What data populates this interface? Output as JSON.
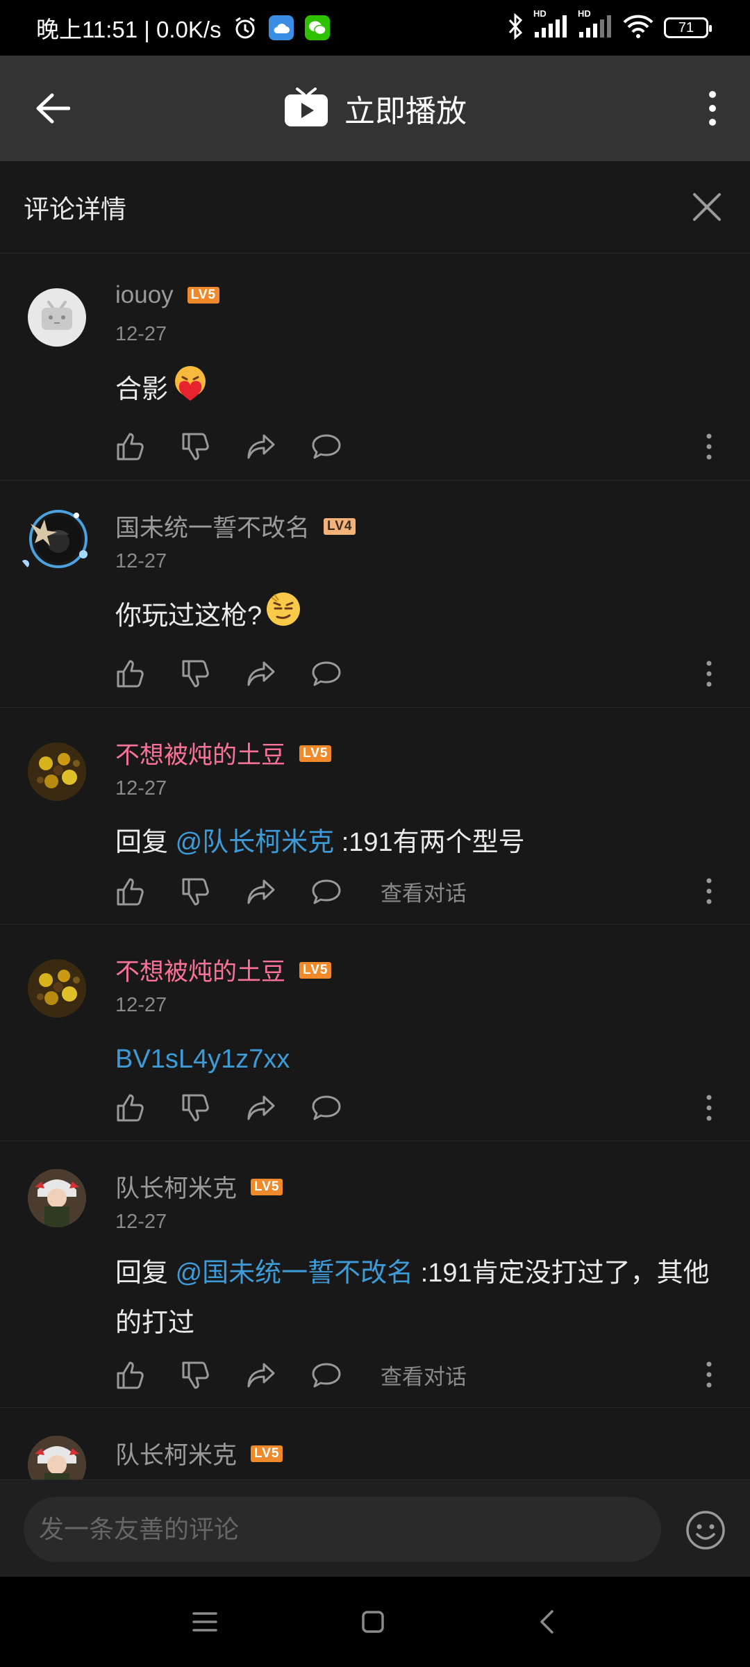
{
  "status_bar": {
    "time": "晚上11:51 | 0.0K/s",
    "hd1": "HD",
    "hd2": "HD",
    "battery": "71"
  },
  "app_bar": {
    "title": "立即播放"
  },
  "detail": {
    "title": "评论详情"
  },
  "comments": [
    {
      "username": "iouoy",
      "level": "LV5",
      "date": "12-27",
      "text": "合影"
    },
    {
      "username": "国未统一誓不改名",
      "level": "LV4",
      "date": "12-27",
      "text": "你玩过这枪?"
    },
    {
      "username": "不想被炖的土豆",
      "level": "LV5",
      "date": "12-27",
      "reply_prefix": "回复 ",
      "mention": "@队长柯米克",
      "text": " :191有两个型号",
      "view_conversation": "查看对话"
    },
    {
      "username": "不想被炖的土豆",
      "level": "LV5",
      "date": "12-27",
      "link": "BV1sL4y1z7xx"
    },
    {
      "username": "队长柯米克",
      "level": "LV5",
      "date": "12-27",
      "reply_prefix": "回复 ",
      "mention": "@国未统一誓不改名",
      "text": " :191肯定没打过了，其他的打过",
      "view_conversation": "查看对话"
    },
    {
      "username": "队长柯米克",
      "level": "LV5"
    }
  ],
  "input_bar": {
    "placeholder": "发一条友善的评论"
  },
  "colors": {
    "background": "#181818",
    "app_bar": "#333333",
    "pink_username": "#fb7299",
    "mention_blue": "#3d9bd8",
    "level_orange": "#f0892a"
  }
}
